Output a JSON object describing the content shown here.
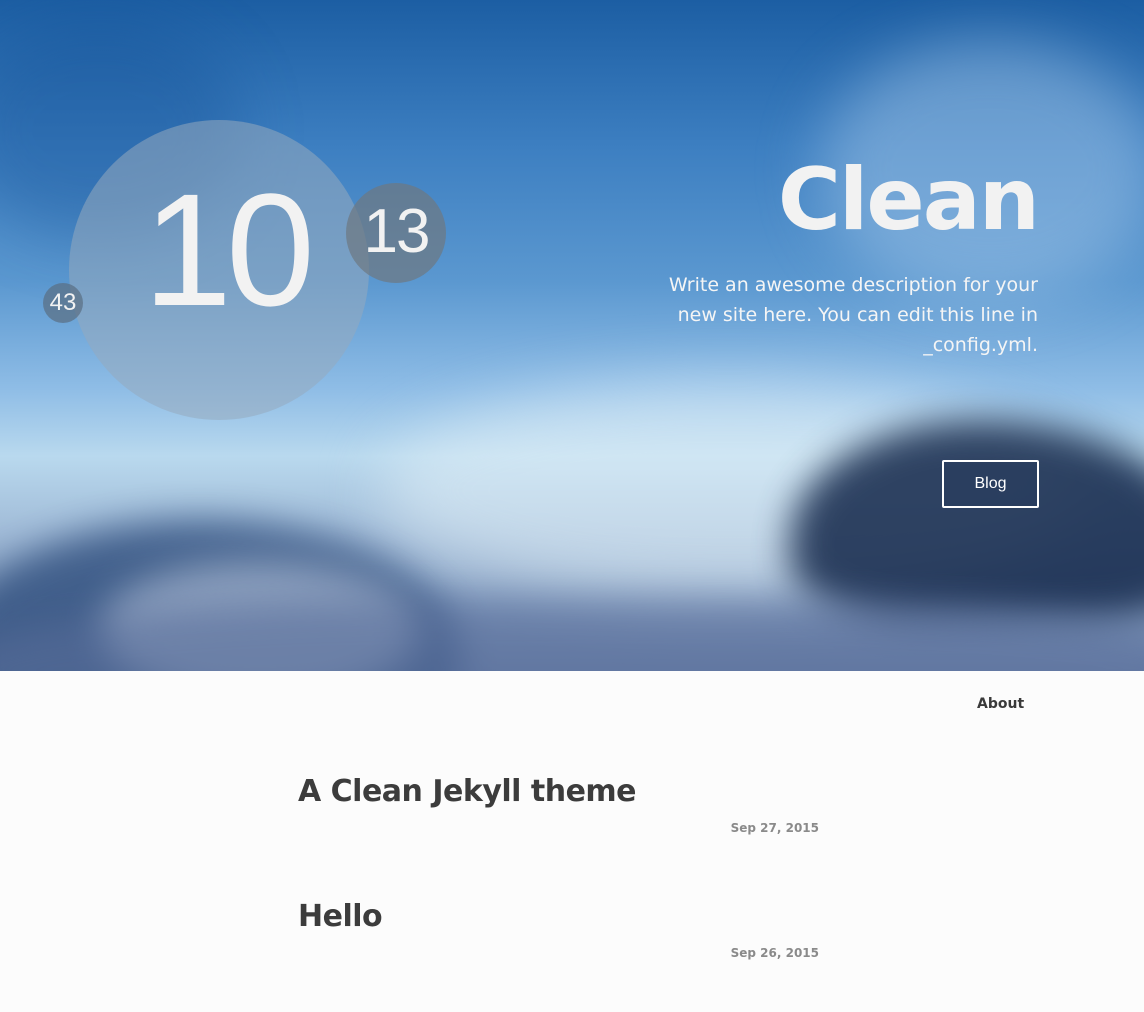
{
  "hero": {
    "clock": {
      "hours": "10",
      "minutes": "13",
      "seconds": "43"
    },
    "title": "Clean",
    "description": "Write an awesome description for your new site here. You can edit this line in _config.yml.",
    "blog_button_label": "Blog"
  },
  "nav": {
    "about_label": "About"
  },
  "posts": [
    {
      "title": "A Clean Jekyll theme",
      "date": "Sep 27, 2015"
    },
    {
      "title": "Hello",
      "date": "Sep 26, 2015"
    }
  ],
  "colors": {
    "sky_top": "#1c5ea3",
    "page_background": "#fcfcfc",
    "heading_text": "#3c3c3c",
    "date_text": "#8a8a8a"
  }
}
